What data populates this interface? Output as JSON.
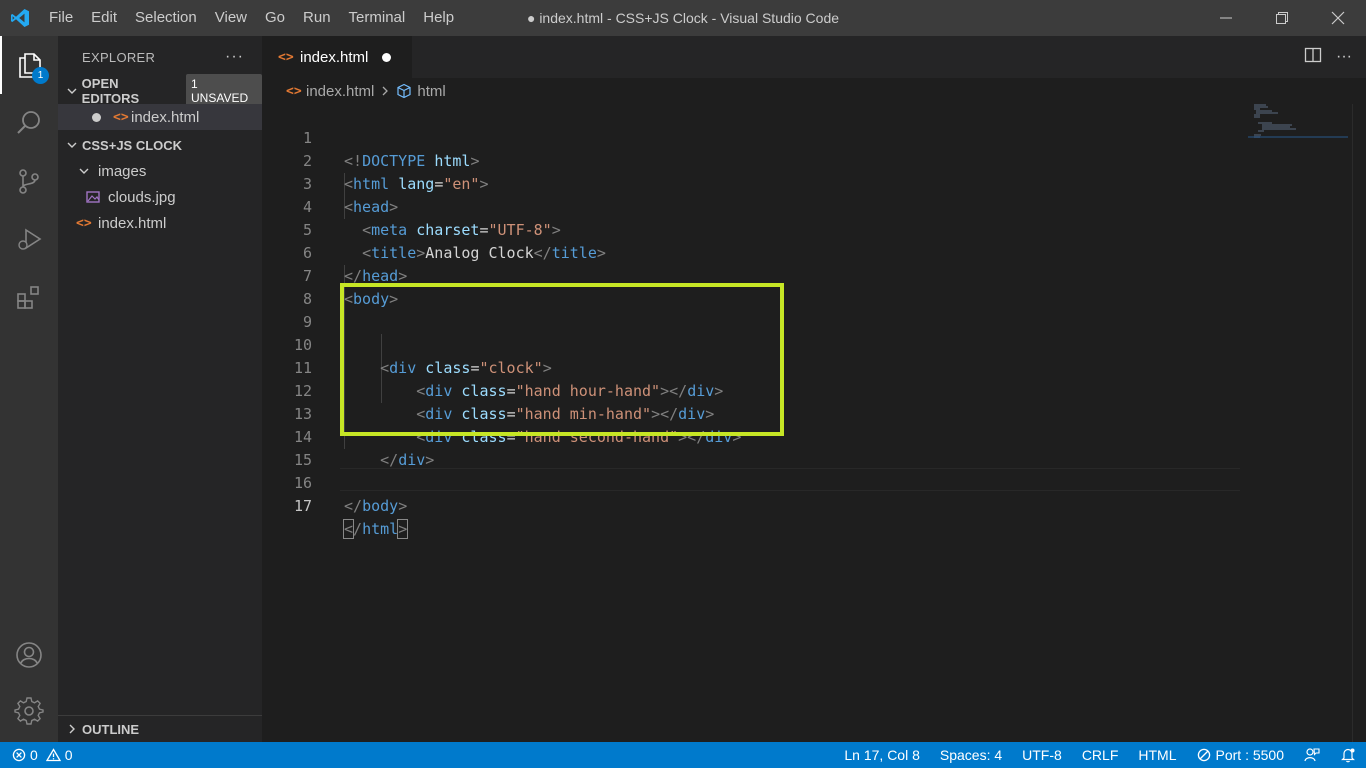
{
  "titlebar": {
    "menu": [
      "File",
      "Edit",
      "Selection",
      "View",
      "Go",
      "Run",
      "Terminal",
      "Help"
    ],
    "title": "● index.html - CSS+JS Clock - Visual Studio Code"
  },
  "activitybar": {
    "explorer_badge": "1"
  },
  "sidebar": {
    "title": "EXPLORER",
    "open_editors": {
      "label": "OPEN EDITORS",
      "badge": "1 UNSAVED",
      "files": [
        "index.html"
      ]
    },
    "project": {
      "label": "CSS+JS CLOCK",
      "folder": "images",
      "folder_file": "clouds.jpg",
      "root_file": "index.html"
    },
    "outline_label": "OUTLINE"
  },
  "tab": {
    "label": "index.html"
  },
  "breadcrumb": {
    "file": "index.html",
    "symbol": "html"
  },
  "editor": {
    "line_numbers": [
      "1",
      "2",
      "3",
      "4",
      "5",
      "6",
      "7",
      "8",
      "9",
      "10",
      "11",
      "12",
      "13",
      "14",
      "15",
      "16",
      "17"
    ],
    "current_line": 17,
    "lines": [
      "<!DOCTYPE html>",
      "<html lang=\"en\">",
      "<head>",
      "  <meta charset=\"UTF-8\">",
      "  <title>Analog Clock</title>",
      "</head>",
      "<body>",
      "",
      "",
      "    <div class=\"clock\">",
      "        <div class=\"hand hour-hand\"></div>",
      "        <div class=\"hand min-hand\"></div>",
      "        <div class=\"hand second-hand\"></div>",
      "    </div>",
      "",
      "</body>",
      "</html>"
    ],
    "highlight_color": "#c6e625"
  },
  "statusbar": {
    "errors": "0",
    "warnings": "0",
    "position": "Ln 17, Col 8",
    "spaces": "Spaces: 4",
    "encoding": "UTF-8",
    "eol": "CRLF",
    "language": "HTML",
    "port": "Port : 5500"
  },
  "colors": {
    "accent": "#007acc",
    "highlight": "#c6e625"
  }
}
